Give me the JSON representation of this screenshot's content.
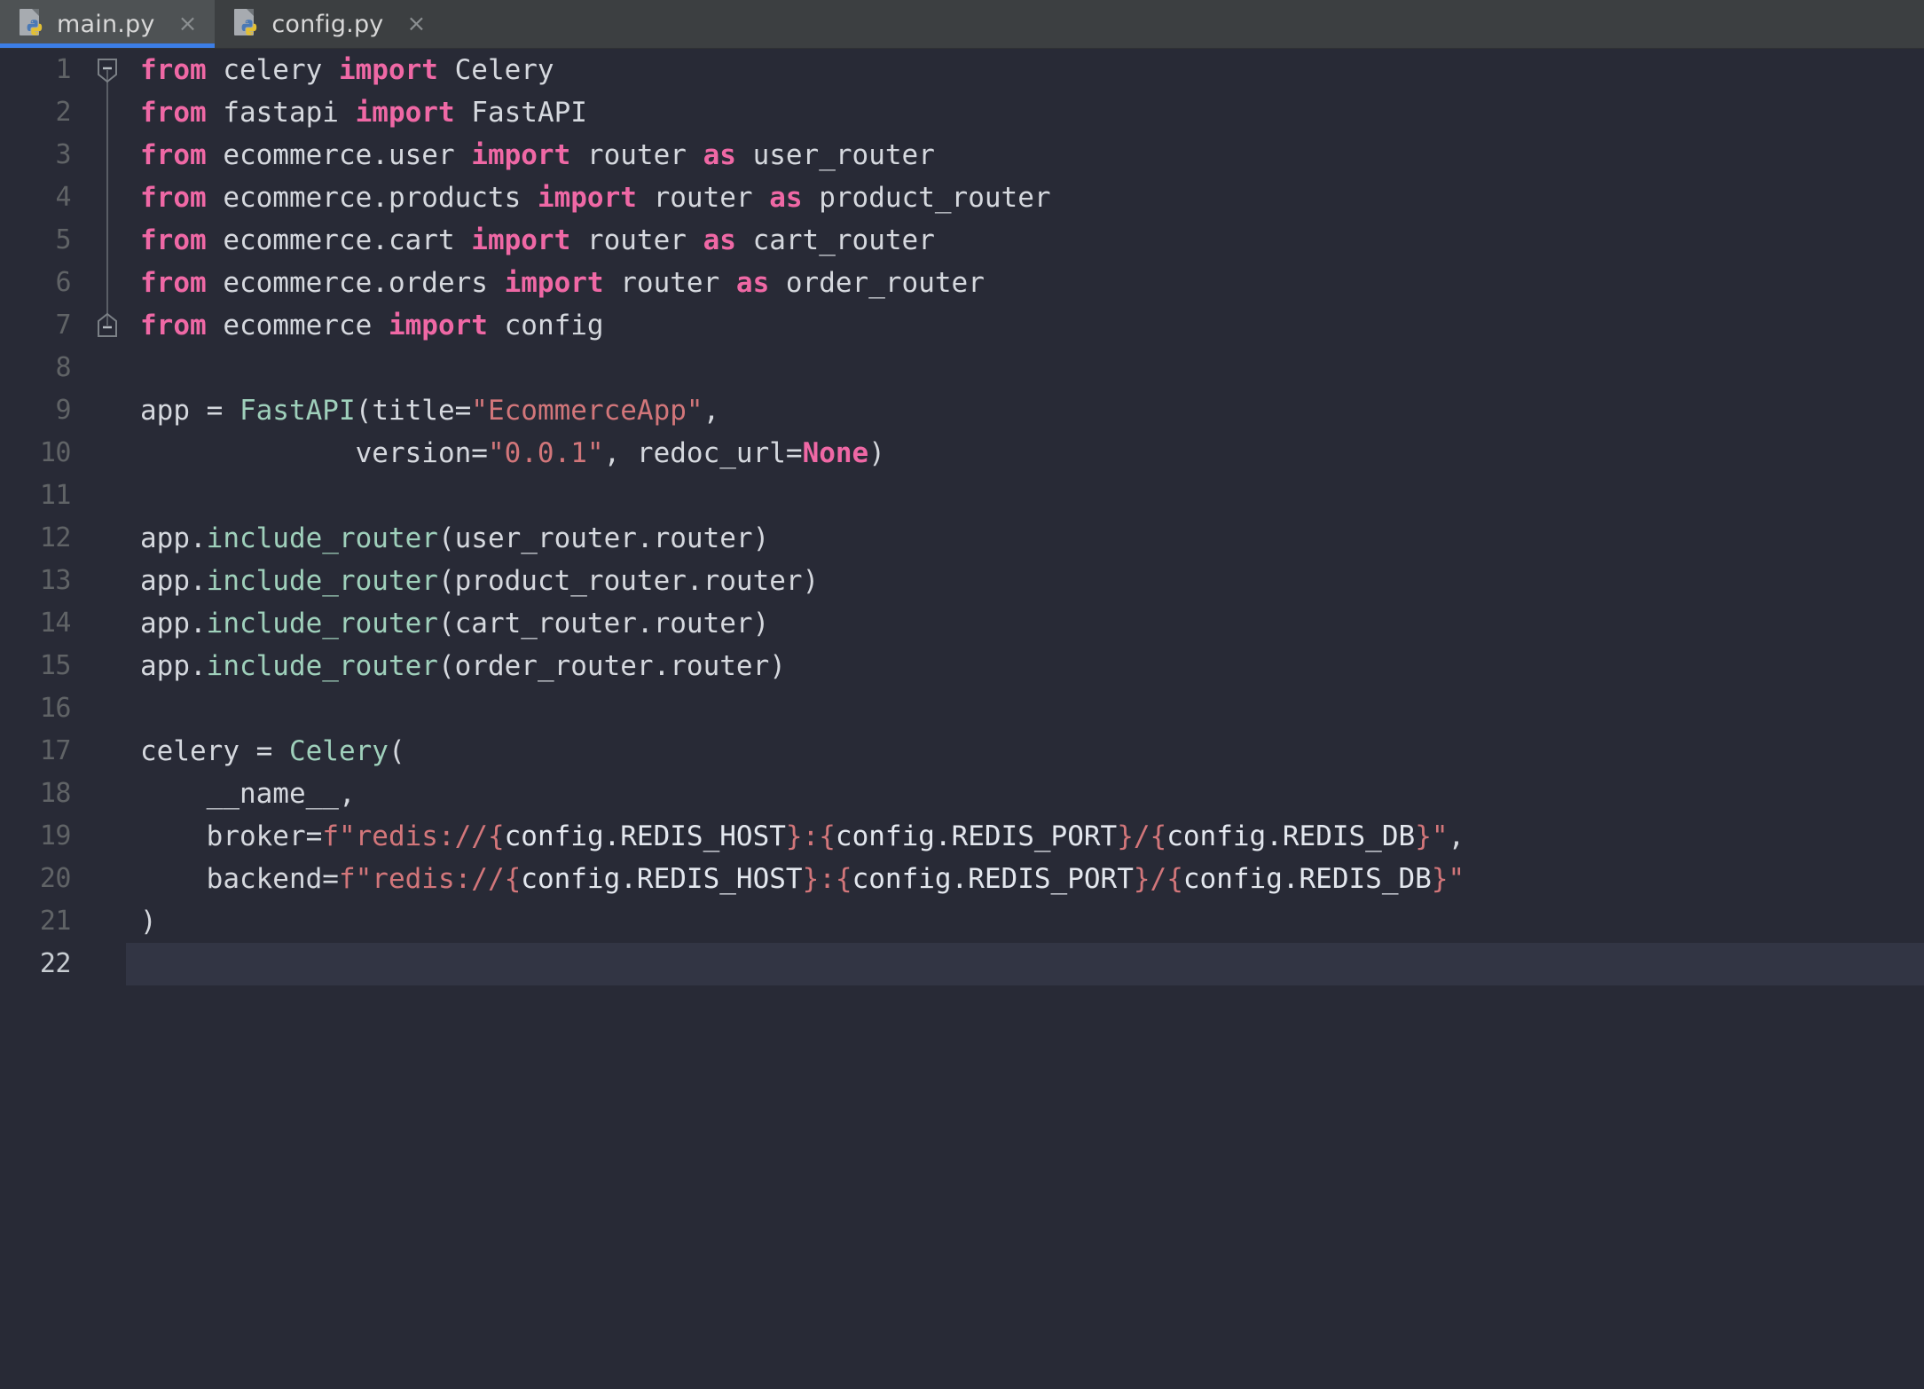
{
  "window": {
    "kind": "code-editor",
    "theme_name": "dark",
    "colors": {
      "tabbar_bg": "#3c3f41",
      "tab_active_bg": "#4e5254",
      "tab_active_underline": "#3c7ee6",
      "editor_bg": "#282a36",
      "current_line_bg": "#323544",
      "line_number": "#606366",
      "line_number_current": "#c8cdd2",
      "default_text": "#bcc6d4",
      "keyword": "#ef68a5",
      "function": "#9fd0bb",
      "class": "#9fd0bb",
      "string": "#d2767a",
      "number": "#d2767a",
      "fold_line": "#5a5e66"
    }
  },
  "tabs": [
    {
      "label": "main.py",
      "icon": "python-file-icon",
      "close_icon": "×",
      "active": true
    },
    {
      "label": "config.py",
      "icon": "python-file-icon",
      "close_icon": "×",
      "active": false
    }
  ],
  "editor": {
    "file": "main.py",
    "language": "python",
    "current_line": 22,
    "total_lines": 22,
    "line_numbers": [
      "1",
      "2",
      "3",
      "4",
      "5",
      "6",
      "7",
      "8",
      "9",
      "10",
      "11",
      "12",
      "13",
      "14",
      "15",
      "16",
      "17",
      "18",
      "19",
      "20",
      "21",
      "22"
    ],
    "fold_markers": [
      {
        "line": 1,
        "state": "expanded",
        "glyph": "minus"
      },
      {
        "line": 7,
        "state": "expanded",
        "glyph": "minus"
      }
    ],
    "lines": [
      {
        "n": 1,
        "text": "from celery import Celery",
        "tokens": [
          [
            "kw",
            "from"
          ],
          [
            "ident",
            " celery "
          ],
          [
            "kw",
            "import"
          ],
          [
            "ident",
            " Celery"
          ]
        ]
      },
      {
        "n": 2,
        "text": "from fastapi import FastAPI",
        "tokens": [
          [
            "kw",
            "from"
          ],
          [
            "ident",
            " fastapi "
          ],
          [
            "kw",
            "import"
          ],
          [
            "ident",
            " FastAPI"
          ]
        ]
      },
      {
        "n": 3,
        "text": "from ecommerce.user import router as user_router",
        "tokens": [
          [
            "kw",
            "from"
          ],
          [
            "ident",
            " ecommerce.user "
          ],
          [
            "kw",
            "import"
          ],
          [
            "ident",
            " router "
          ],
          [
            "kw",
            "as"
          ],
          [
            "ident",
            " user_router"
          ]
        ]
      },
      {
        "n": 4,
        "text": "from ecommerce.products import router as product_router",
        "tokens": [
          [
            "kw",
            "from"
          ],
          [
            "ident",
            " ecommerce.products "
          ],
          [
            "kw",
            "import"
          ],
          [
            "ident",
            " router "
          ],
          [
            "kw",
            "as"
          ],
          [
            "ident",
            " product_router"
          ]
        ]
      },
      {
        "n": 5,
        "text": "from ecommerce.cart import router as cart_router",
        "tokens": [
          [
            "kw",
            "from"
          ],
          [
            "ident",
            " ecommerce.cart "
          ],
          [
            "kw",
            "import"
          ],
          [
            "ident",
            " router "
          ],
          [
            "kw",
            "as"
          ],
          [
            "ident",
            " cart_router"
          ]
        ]
      },
      {
        "n": 6,
        "text": "from ecommerce.orders import router as order_router",
        "tokens": [
          [
            "kw",
            "from"
          ],
          [
            "ident",
            " ecommerce.orders "
          ],
          [
            "kw",
            "import"
          ],
          [
            "ident",
            " router "
          ],
          [
            "kw",
            "as"
          ],
          [
            "ident",
            " order_router"
          ]
        ]
      },
      {
        "n": 7,
        "text": "from ecommerce import config",
        "tokens": [
          [
            "kw",
            "from"
          ],
          [
            "ident",
            " ecommerce "
          ],
          [
            "kw",
            "import"
          ],
          [
            "ident",
            " config"
          ]
        ]
      },
      {
        "n": 8,
        "text": "",
        "tokens": []
      },
      {
        "n": 9,
        "text": "app = FastAPI(title=\"EcommerceApp\",",
        "tokens": [
          [
            "ident",
            "app = "
          ],
          [
            "cls",
            "FastAPI"
          ],
          [
            "punct",
            "("
          ],
          [
            "ident",
            "title="
          ],
          [
            "str",
            "\"EcommerceApp\""
          ],
          [
            "punct",
            ","
          ]
        ]
      },
      {
        "n": 10,
        "text": "             version=\"0.0.1\", redoc_url=None)",
        "tokens": [
          [
            "ident",
            "             version="
          ],
          [
            "str",
            "\"0.0.1\""
          ],
          [
            "punct",
            ", "
          ],
          [
            "ident",
            "redoc_url="
          ],
          [
            "kw",
            "None"
          ],
          [
            "punct",
            ")"
          ]
        ]
      },
      {
        "n": 11,
        "text": "",
        "tokens": []
      },
      {
        "n": 12,
        "text": "app.include_router(user_router.router)",
        "tokens": [
          [
            "ident",
            "app."
          ],
          [
            "fn",
            "include_router"
          ],
          [
            "punct",
            "("
          ],
          [
            "ident",
            "user_router.router"
          ],
          [
            "punct",
            ")"
          ]
        ]
      },
      {
        "n": 13,
        "text": "app.include_router(product_router.router)",
        "tokens": [
          [
            "ident",
            "app."
          ],
          [
            "fn",
            "include_router"
          ],
          [
            "punct",
            "("
          ],
          [
            "ident",
            "product_router.router"
          ],
          [
            "punct",
            ")"
          ]
        ]
      },
      {
        "n": 14,
        "text": "app.include_router(cart_router.router)",
        "tokens": [
          [
            "ident",
            "app."
          ],
          [
            "fn",
            "include_router"
          ],
          [
            "punct",
            "("
          ],
          [
            "ident",
            "cart_router.router"
          ],
          [
            "punct",
            ")"
          ]
        ]
      },
      {
        "n": 15,
        "text": "app.include_router(order_router.router)",
        "tokens": [
          [
            "ident",
            "app."
          ],
          [
            "fn",
            "include_router"
          ],
          [
            "punct",
            "("
          ],
          [
            "ident",
            "order_router.router"
          ],
          [
            "punct",
            ")"
          ]
        ]
      },
      {
        "n": 16,
        "text": "",
        "tokens": []
      },
      {
        "n": 17,
        "text": "celery = Celery(",
        "tokens": [
          [
            "ident",
            "celery = "
          ],
          [
            "cls",
            "Celery"
          ],
          [
            "punct",
            "("
          ]
        ]
      },
      {
        "n": 18,
        "text": "    __name__,",
        "tokens": [
          [
            "ident",
            "    __name__"
          ],
          [
            "punct",
            ","
          ]
        ]
      },
      {
        "n": 19,
        "text": "    broker=f\"redis://{config.REDIS_HOST}:{config.REDIS_PORT}/{config.REDIS_DB}\",",
        "tokens": [
          [
            "ident",
            "    broker="
          ],
          [
            "str",
            "f\"redis://"
          ],
          [
            "str",
            "{"
          ],
          [
            "interp",
            "config.REDIS_HOST"
          ],
          [
            "str",
            "}"
          ],
          [
            "str",
            ":"
          ],
          [
            "str",
            "{"
          ],
          [
            "interp",
            "config.REDIS_PORT"
          ],
          [
            "str",
            "}"
          ],
          [
            "str",
            "/"
          ],
          [
            "str",
            "{"
          ],
          [
            "interp",
            "config.REDIS_DB"
          ],
          [
            "str",
            "}"
          ],
          [
            "str",
            "\""
          ],
          [
            "punct",
            ","
          ]
        ]
      },
      {
        "n": 20,
        "text": "    backend=f\"redis://{config.REDIS_HOST}:{config.REDIS_PORT}/{config.REDIS_DB}\"",
        "tokens": [
          [
            "ident",
            "    backend="
          ],
          [
            "str",
            "f\"redis://"
          ],
          [
            "str",
            "{"
          ],
          [
            "interp",
            "config.REDIS_HOST"
          ],
          [
            "str",
            "}"
          ],
          [
            "str",
            ":"
          ],
          [
            "str",
            "{"
          ],
          [
            "interp",
            "config.REDIS_PORT"
          ],
          [
            "str",
            "}"
          ],
          [
            "str",
            "/"
          ],
          [
            "str",
            "{"
          ],
          [
            "interp",
            "config.REDIS_DB"
          ],
          [
            "str",
            "}"
          ],
          [
            "str",
            "\""
          ]
        ]
      },
      {
        "n": 21,
        "text": ")",
        "tokens": [
          [
            "punct",
            ")"
          ]
        ]
      },
      {
        "n": 22,
        "text": "",
        "tokens": []
      }
    ]
  }
}
